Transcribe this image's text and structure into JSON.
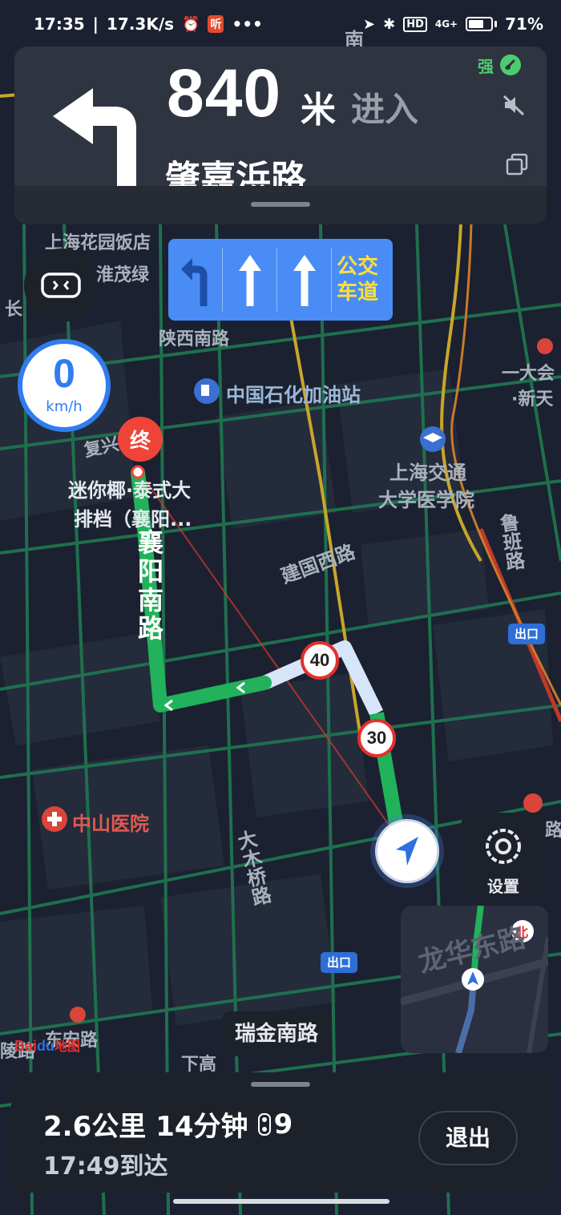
{
  "status_bar": {
    "time": "17:35",
    "net_speed": "17.3K/s",
    "app_badge": "听",
    "more": "•••",
    "hd": "HD",
    "net_type": "4G+",
    "battery_percent": "71%",
    "battery_level": 0.71
  },
  "guidance": {
    "distance": "840",
    "unit": "米",
    "action": "进入",
    "road": "肇嘉浜路",
    "signal_label": "强",
    "turn_direction": "left-turn-icon"
  },
  "lanes": {
    "items": [
      "left-turn-icon",
      "straight-icon",
      "straight-icon"
    ],
    "bus_lane": "公交\n车道"
  },
  "speed": {
    "value": "0",
    "unit": "km/h"
  },
  "map": {
    "labels": [
      {
        "text": "上海花园饭店"
      },
      {
        "text": "淮茂绿"
      },
      {
        "text": "陕西南路"
      },
      {
        "text": "中国石化加油站"
      },
      {
        "text": "复兴路"
      },
      {
        "text": "迷你椰·泰式大"
      },
      {
        "text": "排档（襄阳..."
      },
      {
        "text": "上海交通"
      },
      {
        "text": "大学医学院"
      },
      {
        "text": "建国西路"
      },
      {
        "text": "鲁班路"
      },
      {
        "text": "一大会"
      },
      {
        "text": "·新天"
      },
      {
        "text": "中山医院"
      },
      {
        "text": "大木桥路"
      },
      {
        "text": "龙华东路"
      },
      {
        "text": "东安路"
      },
      {
        "text": "南"
      },
      {
        "text": "长"
      },
      {
        "text": "陵路"
      },
      {
        "text": "路"
      },
      {
        "text": "下高"
      }
    ],
    "vertical_road": "襄\n阳\n南\n路",
    "end_marker": "终",
    "speed_limits": [
      "40",
      "30"
    ],
    "exit_badges": [
      "出口",
      "出口"
    ],
    "current_street": "瑞金南路",
    "compass": "北"
  },
  "settings": {
    "label": "设置"
  },
  "branding": {
    "bai": "Bai",
    "du": "du",
    "ditu": "地图"
  },
  "trip": {
    "distance": "2.6公里",
    "duration": "14分钟",
    "traffic_lights": "9",
    "eta": "17:49到达",
    "exit_label": "退出"
  },
  "colors": {
    "route_green": "#21b25b",
    "route_passed": "#d7e5fb",
    "lane_blue": "#4a8cf5",
    "speed_blue": "#2f7df0",
    "end_red": "#f04438",
    "bus_yellow": "#ffe03a",
    "panel_bg": "#2e3440"
  }
}
